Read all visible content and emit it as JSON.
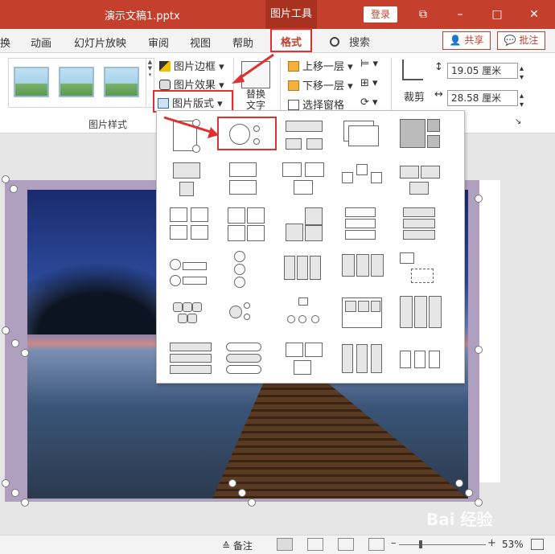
{
  "titlebar": {
    "document_title": "演示文稿1.pptx",
    "context_tool": "图片工具",
    "login_label": "登录",
    "restore_glyph": "⧉",
    "minimize_glyph": "–",
    "maximize_glyph": "□",
    "close_glyph": "✕"
  },
  "tabs": [
    "换",
    "动画",
    "幻灯片放映",
    "审阅",
    "视图",
    "帮助",
    "格式"
  ],
  "active_tab": "格式",
  "search": {
    "label": "搜索",
    "icon": "search-icon"
  },
  "share_label": "共享",
  "comment_label": "批注",
  "ribbon": {
    "picture_border": "图片边框",
    "picture_effects": "图片效果",
    "picture_layout": "图片版式",
    "alt_text": "替换文字",
    "bring_forward": "上移一层",
    "send_backward": "下移一层",
    "selection_pane": "选择窗格",
    "crop": "裁剪",
    "height_value": "19.05 厘米",
    "width_value": "28.58 厘米",
    "group_label": "图片样式"
  },
  "accent_color": "#c4402d",
  "highlight_color": "#e03030",
  "statusbar": {
    "notes_label": "备注",
    "zoom_percent": "53%"
  },
  "watermark": "Bai 经验"
}
